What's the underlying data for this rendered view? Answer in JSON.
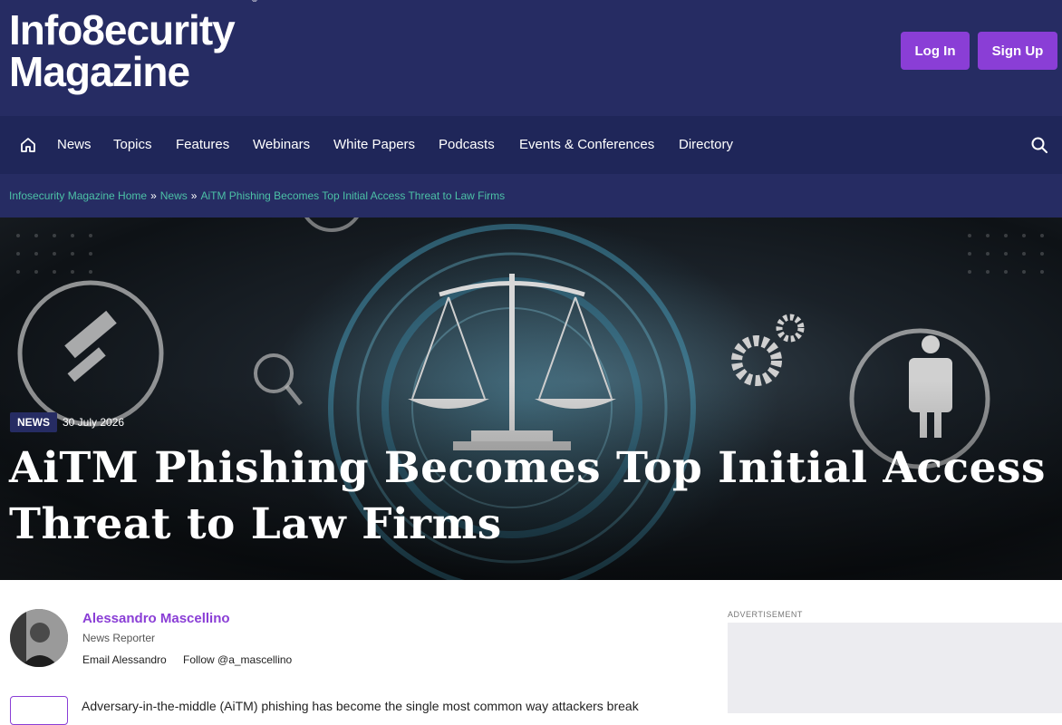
{
  "brand": {
    "line1": "Info8ecurity",
    "line2": "Magazine",
    "registered": "®"
  },
  "header": {
    "login_label": "Log In",
    "signup_label": "Sign Up"
  },
  "nav": {
    "items": [
      {
        "label": "News"
      },
      {
        "label": "Topics"
      },
      {
        "label": "Features"
      },
      {
        "label": "Webinars"
      },
      {
        "label": "White Papers"
      },
      {
        "label": "Podcasts"
      },
      {
        "label": "Events & Conferences"
      },
      {
        "label": "Directory"
      }
    ],
    "icons": {
      "home": "home-icon",
      "search": "search-icon"
    }
  },
  "breadcrumb": {
    "items": [
      "Infosecurity Magazine Home",
      "News",
      "AiTM Phishing Becomes Top Initial Access Threat to Law Firms"
    ],
    "separator": "»"
  },
  "article": {
    "category": "NEWS",
    "date": "30 July 2026",
    "title": "AiTM Phishing Becomes Top Initial Access Threat to Law Firms",
    "lead": "Adversary-in-the-middle (AiTM) phishing has become the single most common way attackers break"
  },
  "author": {
    "name": "Alessandro Mascellino",
    "role": "News Reporter",
    "email_label": "Email Alessandro",
    "follow_label": "Follow @a_mascellino"
  },
  "sidebar": {
    "ad_label": "ADVERTISEMENT"
  },
  "colors": {
    "header_bg": "#262c63",
    "nav_bg": "#1f2659",
    "accent": "#8a3ed6",
    "breadcrumb_link": "#4cc1a6"
  }
}
